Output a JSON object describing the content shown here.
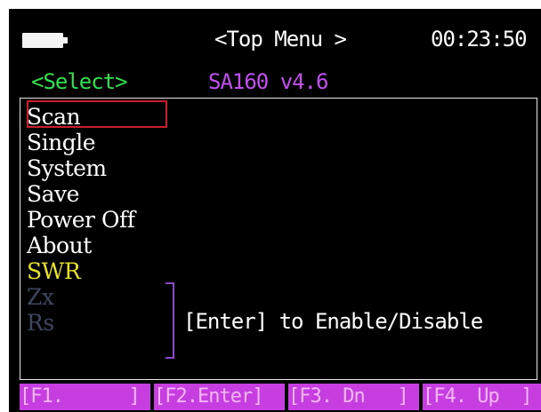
{
  "header": {
    "battery_icon": "battery-icon",
    "title": "<Top Menu >",
    "clock": "00:23:50"
  },
  "status": {
    "select_label": "<Select>",
    "model": "SA160 v4.6"
  },
  "menu": {
    "items": [
      {
        "label": "Scan",
        "color": "#ffffff",
        "selected": true
      },
      {
        "label": "Single",
        "color": "#ffffff"
      },
      {
        "label": "System",
        "color": "#ffffff"
      },
      {
        "label": "Save",
        "color": "#ffffff"
      },
      {
        "label": "Power Off",
        "color": "#ffffff"
      },
      {
        "label": "About",
        "color": "#ffffff"
      },
      {
        "label": "SWR",
        "color": "#e6e12a"
      },
      {
        "label": "Zx",
        "color": "#3e4660"
      },
      {
        "label": "Rs",
        "color": "#3e4660"
      }
    ],
    "hint": "[Enter] to Enable/Disable"
  },
  "function_keys": [
    {
      "label": "[F1.      ]"
    },
    {
      "label": "[F2.Enter]"
    },
    {
      "label": "[F3. Dn   ]"
    },
    {
      "label": "[F4. Up  ]"
    }
  ],
  "colors": {
    "background": "#000000",
    "header_text": "#ffffff",
    "select_label": "#2fe24c",
    "model": "#c44ff0",
    "cursor": "#c91f2a",
    "bracket": "#8b47c4",
    "function_key_bg": "#c63ee0",
    "function_key_text": "#f3b7f7"
  }
}
